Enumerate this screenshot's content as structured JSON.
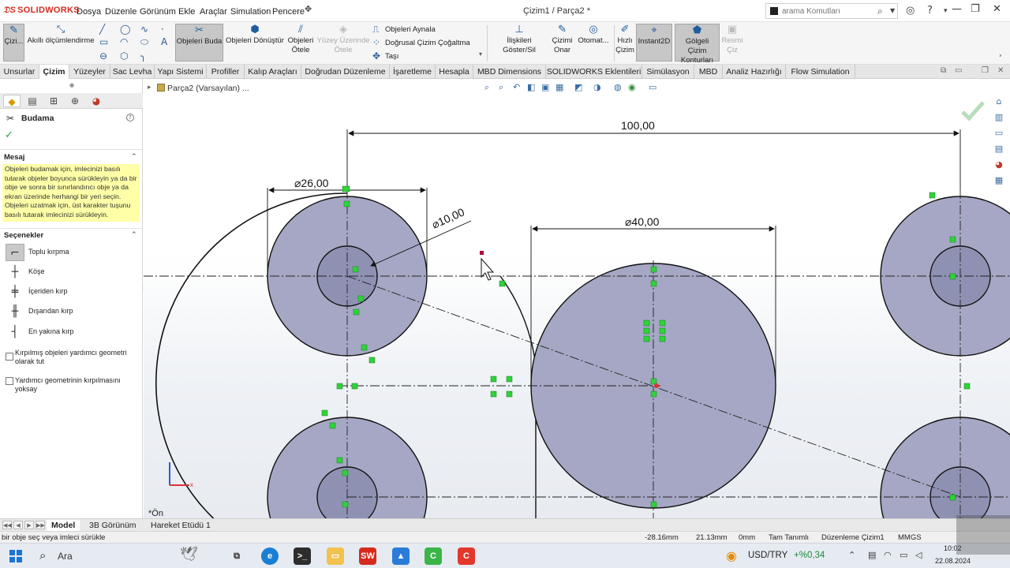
{
  "app": {
    "logo_text": "SOLIDWORKS",
    "doc_title": "Çizim1 / Parça2 *",
    "menu": [
      "Dosya",
      "Düzenle",
      "Görünüm",
      "Ekle",
      "Araçlar",
      "Simulation",
      "Pencere"
    ],
    "search_placeholder": "arama Komutları"
  },
  "ribbon": {
    "sketch": "Çizi...",
    "smart_dim": "Akıllı ölçümlendirme",
    "trim": "Objeleri Buda",
    "convert": "Objeleri Dönüştür",
    "offset": [
      "Objeleri",
      "Ötele"
    ],
    "offset_surface": [
      "Yüzey Üzerinde",
      "Ötele"
    ],
    "mirror": "Objeleri Aynala",
    "linear_pattern": "Doğrusal Çizim Çoğaltma",
    "move": "Taşı",
    "relations": "İlişkileri Göster/Sil",
    "repair": [
      "Çizimi",
      "Onar"
    ],
    "auto": "Otomat...",
    "rapid": [
      "Hızlı",
      "Çizim"
    ],
    "instant2d": "Instant2D",
    "shaded": [
      "Gölgeli Çizim",
      "Konturları"
    ],
    "picture": [
      "Resmi",
      "Çiz"
    ]
  },
  "tabs": [
    "Unsurlar",
    "Çizim",
    "Yüzeyler",
    "Sac Levha",
    "Yapı Sistemi",
    "Profiller",
    "Kalıp Araçları",
    "Doğrudan Düzenleme",
    "İşaretleme",
    "Hesapla",
    "MBD Dimensions",
    "SOLIDWORKS Eklentileri",
    "Simülasyon",
    "MBD",
    "Analiz Hazırlığı",
    "Flow Simulation"
  ],
  "active_tab": "Çizim",
  "property_manager": {
    "title": "Budama",
    "message_header": "Mesaj",
    "message": "Objeleri budamak için, imlecinizi basılı tutarak objeler boyunca sürükleyin ya da bir obje ve sonra bir sınırlandırıcı obje ya da ekran üzerinde herhangi bir yeri seçin. Objeleri uzatmak için, üst karakter tuşunu basılı tutarak imlecinizi sürükleyin.",
    "options_header": "Seçenekler",
    "options": [
      "Toplu kırpma",
      "Köşe",
      "İçeriden kırp",
      "Dışarıdan kırp",
      "En yakına kırp"
    ],
    "selected_option": "Toplu kırpma",
    "checkbox_keep": "Kırpılmış objeleri yardımcı geometri olarak tut",
    "checkbox_ignore": "Yardımcı geometrinin kırpılmasını yoksay",
    "checkbox_keep_checked": false,
    "checkbox_ignore_checked": false
  },
  "graphics": {
    "breadcrumb": "Parça2 (Varsayılan) ...",
    "view_label": "*Ön",
    "dimensions": {
      "top_width": "100,00",
      "small_dia": "⌀26,00",
      "radius": "⌀10,00",
      "center_dia": "⌀40,00"
    },
    "accent_color": "#2fd23a",
    "fill_color": "#9a9cbc"
  },
  "model_tabs": [
    "Model",
    "3B Görünüm",
    "Hareket Etüdü 1"
  ],
  "active_model_tab": "Model",
  "status": {
    "hint": "bir obje seç veya imleci sürükle",
    "x": "-28.16mm",
    "y": "21.13mm",
    "z": "0mm",
    "defined": "Tam Tanımlı",
    "mode": "Düzenleme Çizim1",
    "units": "MMGS"
  },
  "taskbar": {
    "search": "Ara",
    "currency": "USD/TRY",
    "change": "+%0,34",
    "time": "10:02",
    "date": "22.08.2024"
  }
}
